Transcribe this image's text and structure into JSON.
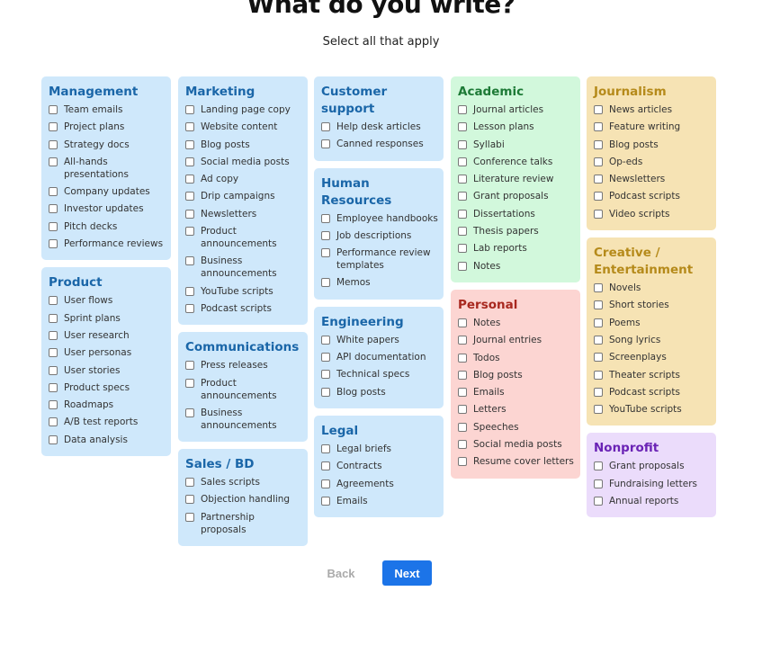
{
  "header": {
    "title": "What do you write?",
    "subtitle": "Select all that apply"
  },
  "columns": [
    [
      {
        "title": "Management",
        "color": "blue",
        "items": [
          "Team emails",
          "Project plans",
          "Strategy docs",
          "All-hands presentations",
          "Company updates",
          "Investor updates",
          "Pitch decks",
          "Performance reviews"
        ]
      },
      {
        "title": "Product",
        "color": "blue",
        "items": [
          "User flows",
          "Sprint plans",
          "User research",
          "User personas",
          "User stories",
          "Product specs",
          "Roadmaps",
          "A/B test reports",
          "Data analysis"
        ]
      }
    ],
    [
      {
        "title": "Marketing",
        "color": "blue",
        "items": [
          "Landing page copy",
          "Website content",
          "Blog posts",
          "Social media posts",
          "Ad copy",
          "Drip campaigns",
          "Newsletters",
          "Product announcements",
          "Business announcements",
          "YouTube scripts",
          "Podcast scripts"
        ]
      },
      {
        "title": "Communications",
        "color": "blue",
        "items": [
          "Press releases",
          "Product announcements",
          "Business announcements"
        ]
      },
      {
        "title": "Sales / BD",
        "color": "blue",
        "items": [
          "Sales scripts",
          "Objection handling",
          "Partnership proposals"
        ]
      }
    ],
    [
      {
        "title": "Customer support",
        "color": "blue",
        "items": [
          "Help desk articles",
          "Canned responses"
        ]
      },
      {
        "title": "Human Resources",
        "color": "blue",
        "items": [
          "Employee handbooks",
          "Job descriptions",
          "Performance review templates",
          "Memos"
        ]
      },
      {
        "title": "Engineering",
        "color": "blue",
        "items": [
          "White papers",
          "API documentation",
          "Technical specs",
          "Blog posts"
        ]
      },
      {
        "title": "Legal",
        "color": "blue",
        "items": [
          "Legal briefs",
          "Contracts",
          "Agreements",
          "Emails"
        ]
      }
    ],
    [
      {
        "title": "Academic",
        "color": "green",
        "items": [
          "Journal articles",
          "Lesson plans",
          "Syllabi",
          "Conference talks",
          "Literature review",
          "Grant proposals",
          "Dissertations",
          "Thesis papers",
          "Lab reports",
          "Notes"
        ]
      },
      {
        "title": "Personal",
        "color": "red",
        "items": [
          "Notes",
          "Journal entries",
          "Todos",
          "Blog posts",
          "Emails",
          "Letters",
          "Speeches",
          "Social media posts",
          "Resume cover letters"
        ]
      }
    ],
    [
      {
        "title": "Journalism",
        "color": "yellow",
        "items": [
          "News articles",
          "Feature writing",
          "Blog posts",
          "Op-eds",
          "Newsletters",
          "Podcast scripts",
          "Video scripts"
        ]
      },
      {
        "title": "Creative / Entertainment",
        "color": "yellow",
        "items": [
          "Novels",
          "Short stories",
          "Poems",
          "Song lyrics",
          "Screenplays",
          "Theater scripts",
          "Podcast scripts",
          "YouTube scripts"
        ]
      },
      {
        "title": "Nonprofit",
        "color": "purple",
        "items": [
          "Grant proposals",
          "Fundraising letters",
          "Annual reports"
        ]
      }
    ]
  ],
  "colors": {
    "blue": "#cfe8fb",
    "green": "#d2f8dc",
    "red": "#fcd5d2",
    "yellow": "#f6e3b4",
    "purple": "#ebdcfb",
    "primary_button": "#1c74e8"
  },
  "nav": {
    "back_label": "Back",
    "next_label": "Next"
  }
}
